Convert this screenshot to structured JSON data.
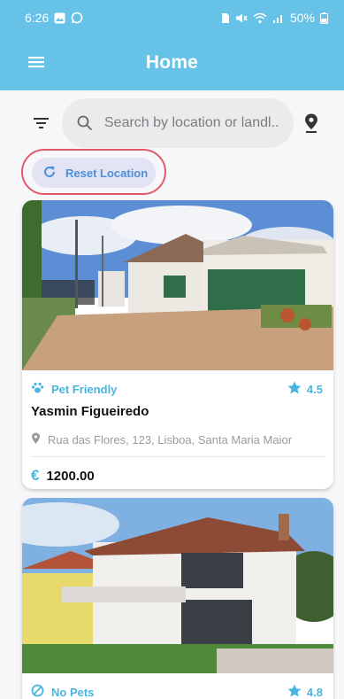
{
  "status_bar": {
    "time": "6:26",
    "battery": "50%"
  },
  "app_bar": {
    "title": "Home"
  },
  "search": {
    "placeholder": "Search by location or landl..."
  },
  "reset_button": {
    "label": "Reset Location"
  },
  "listings": [
    {
      "tag": "Pet Friendly",
      "rating": "4.5",
      "owner": "Yasmin Figueiredo",
      "address": "Rua das Flores, 123, Lisboa, Santa Maria Maior",
      "currency_symbol": "€",
      "price": "1200.00"
    },
    {
      "tag": "No Pets",
      "rating": "4.8"
    }
  ],
  "colors": {
    "primary": "#66c2e6",
    "accent": "#48b4e0",
    "highlight_ring": "#e05a6a"
  }
}
